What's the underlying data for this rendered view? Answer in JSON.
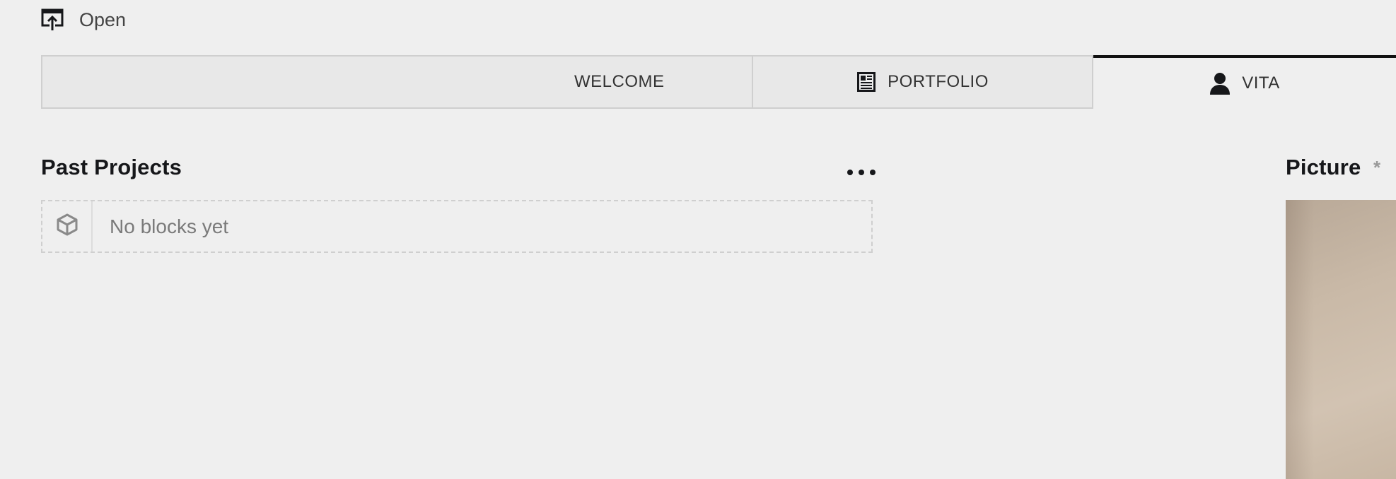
{
  "toolbar": {
    "open_label": "Open",
    "open_icon": "open-external-icon"
  },
  "tabs": [
    {
      "label": "WELCOME",
      "icon": null,
      "active": false
    },
    {
      "label": "PORTFOLIO",
      "icon": "document-icon",
      "active": false
    },
    {
      "label": "VITA",
      "icon": "user-icon",
      "active": true
    }
  ],
  "past_projects": {
    "title": "Past Projects",
    "options_icon": "dots-icon",
    "empty_text": "No blocks yet",
    "empty_icon": "box-icon"
  },
  "picture": {
    "title": "Picture",
    "required_marker": "*"
  },
  "colors": {
    "background": "#efefef",
    "tab_inactive": "#e8e8e8",
    "border": "#cfcfcf",
    "text_dark": "#16171a",
    "text_muted": "#7a7a7a"
  }
}
